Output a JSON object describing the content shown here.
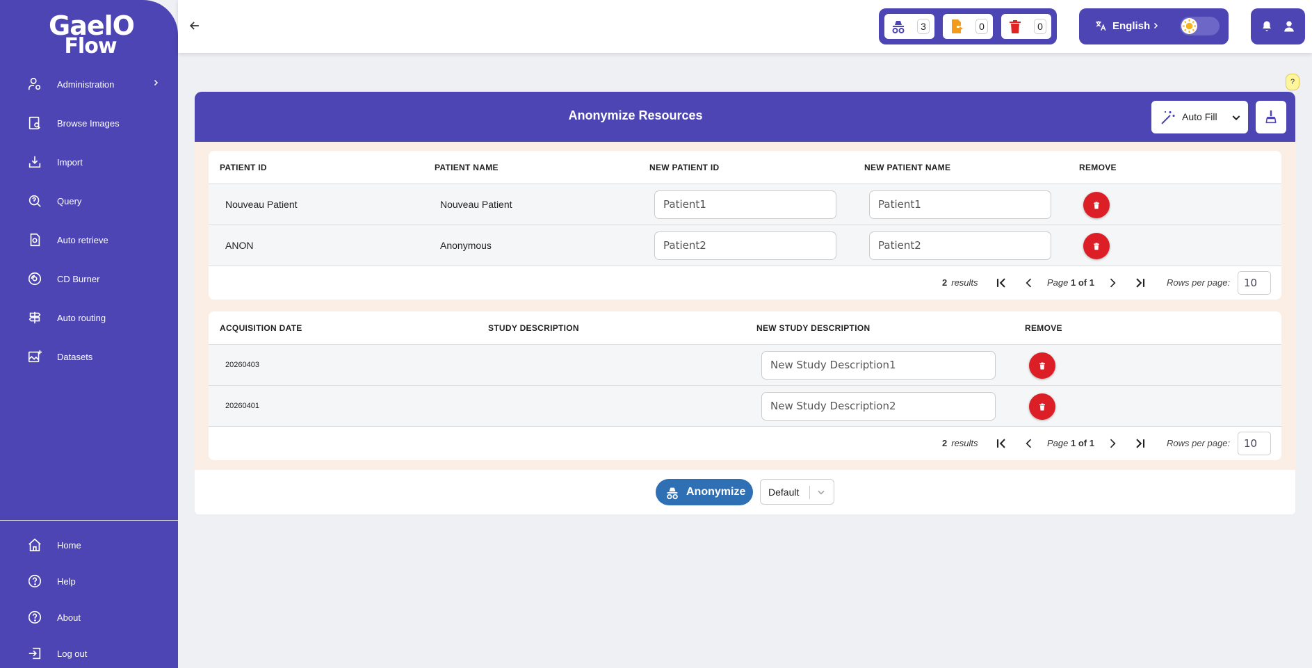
{
  "app": {
    "logo_line1": "GaelO",
    "logo_line2": "Flow"
  },
  "sidebar": {
    "items": [
      {
        "label": "Administration",
        "icon": "user-cog-icon"
      },
      {
        "label": "Browse Images",
        "icon": "browse-images-icon"
      },
      {
        "label": "Import",
        "icon": "import-icon"
      },
      {
        "label": "Query",
        "icon": "query-icon"
      },
      {
        "label": "Auto retrieve",
        "icon": "auto-retrieve-icon"
      },
      {
        "label": "CD Burner",
        "icon": "cd-icon"
      },
      {
        "label": "Auto routing",
        "icon": "signpost-icon"
      },
      {
        "label": "Datasets",
        "icon": "datasets-icon"
      }
    ],
    "bottom_items": [
      {
        "label": "Home",
        "icon": "home-icon"
      },
      {
        "label": "Help",
        "icon": "help-icon"
      },
      {
        "label": "About",
        "icon": "about-icon"
      },
      {
        "label": "Log out",
        "icon": "logout-icon"
      }
    ]
  },
  "topbar": {
    "counters": {
      "anonymize": "3",
      "export": "0",
      "delete": "0"
    },
    "language": "English",
    "theme": "light"
  },
  "help_badge": "?",
  "card": {
    "title": "Anonymize Resources",
    "autofill_label": "Auto Fill"
  },
  "patients_table": {
    "headers": [
      "PATIENT ID",
      "PATIENT NAME",
      "NEW PATIENT ID",
      "NEW PATIENT NAME",
      "REMOVE"
    ],
    "rows": [
      {
        "patient_id": "Nouveau Patient",
        "patient_name": "Nouveau Patient",
        "new_id": "Patient1",
        "new_name": "Patient1"
      },
      {
        "patient_id": "ANON",
        "patient_name": "Anonymous",
        "new_id": "Patient2",
        "new_name": "Patient2"
      }
    ],
    "pager": {
      "results_count": "2",
      "results_label": "results",
      "page_label": "Page",
      "page_current": "1",
      "page_of": "of",
      "page_total": "1",
      "rows_label": "Rows per page:",
      "rows_value": "10"
    }
  },
  "studies_table": {
    "headers": [
      "ACQUISITION DATE",
      "STUDY DESCRIPTION",
      "NEW STUDY DESCRIPTION",
      "REMOVE"
    ],
    "rows": [
      {
        "date": "20260403",
        "description": "",
        "new_description": "New Study Description1"
      },
      {
        "date": "20260401",
        "description": "",
        "new_description": "New Study Description2"
      }
    ],
    "pager": {
      "results_count": "2",
      "results_label": "results",
      "page_label": "Page",
      "page_current": "1",
      "page_of": "of",
      "page_total": "1",
      "rows_label": "Rows per page:",
      "rows_value": "10"
    }
  },
  "footer": {
    "anonymize_label": "Anonymize",
    "profile_value": "Default"
  },
  "colors": {
    "brand": "#4c45b3",
    "delete": "#dc1f26",
    "primary_button": "#2f6fb4",
    "panel_bg": "#fbeee4"
  }
}
